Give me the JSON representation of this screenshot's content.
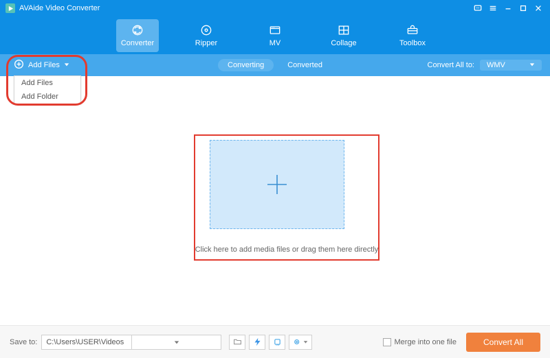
{
  "titlebar": {
    "app_name": "AVAide Video Converter"
  },
  "tabs": {
    "converter": "Converter",
    "ripper": "Ripper",
    "mv": "MV",
    "collage": "Collage",
    "toolbox": "Toolbox"
  },
  "subbar": {
    "add_files": "Add Files",
    "converting": "Converting",
    "converted": "Converted",
    "convert_all_to": "Convert All to:",
    "format": "WMV"
  },
  "dropdown": {
    "add_files": "Add Files",
    "add_folder": "Add Folder"
  },
  "workspace": {
    "drop_text": "Click here to add media files or drag them here directly"
  },
  "bottombar": {
    "save_to": "Save to:",
    "path": "C:\\Users\\USER\\Videos",
    "merge": "Merge into one file",
    "convert_all": "Convert All"
  }
}
